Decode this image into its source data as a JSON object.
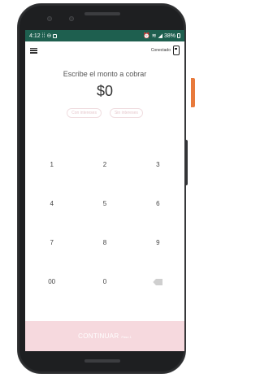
{
  "statusbar": {
    "time": "4:12",
    "battery": "38%"
  },
  "appbar": {
    "connection_label": "Conectado"
  },
  "main": {
    "prompt": "Escribe el monto a cobrar",
    "amount": "$0",
    "chips": [
      "Con intereses",
      "Sin intereses"
    ]
  },
  "keypad": {
    "keys": [
      "1",
      "2",
      "3",
      "4",
      "5",
      "6",
      "7",
      "8",
      "9",
      "00",
      "0"
    ]
  },
  "continue": {
    "label": "CONTINUAR",
    "sub": "Paso 1"
  },
  "colors": {
    "statusbar": "#1e5f4f",
    "continue_bg": "#f6d9de",
    "side_button": "#e87a3c"
  }
}
